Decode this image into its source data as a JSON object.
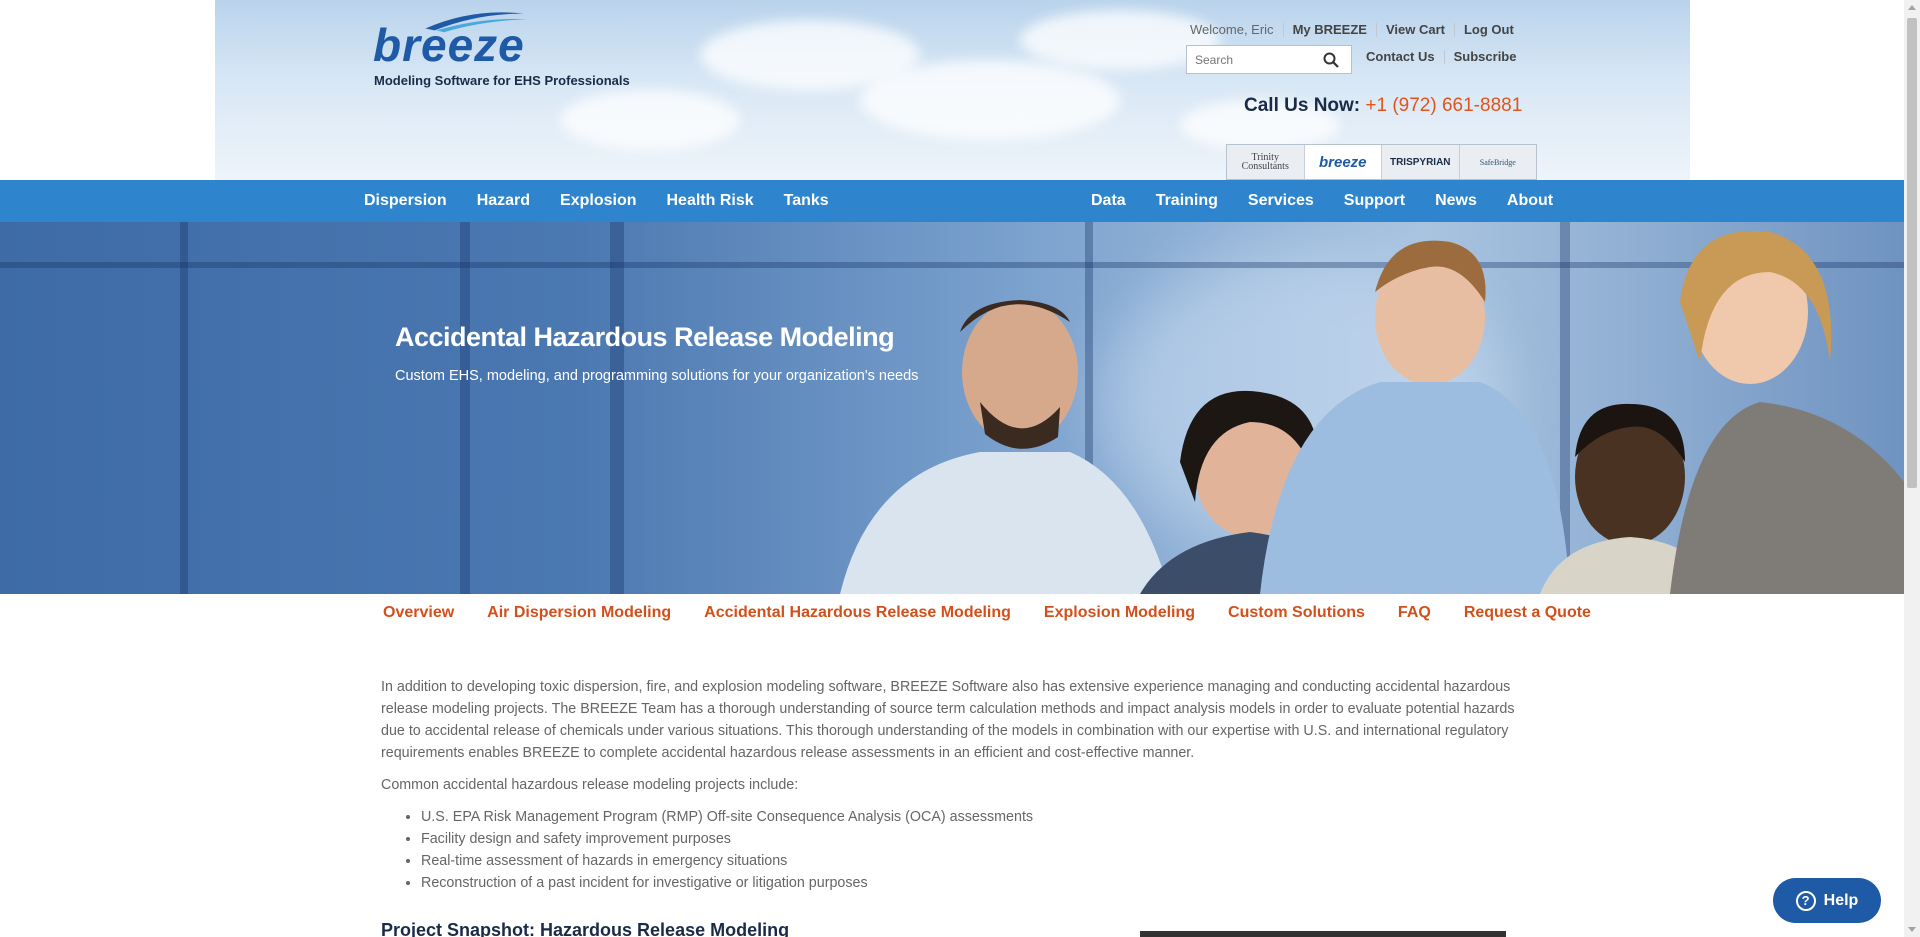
{
  "header": {
    "logo_text": "breeze",
    "tagline": "Modeling Software for EHS Professionals",
    "welcome": "Welcome, Eric",
    "my_breeze": "My BREEZE",
    "view_cart": "View Cart",
    "log_out": "Log Out",
    "search_placeholder": "Search",
    "contact_us": "Contact Us",
    "subscribe": "Subscribe",
    "call_label": "Call Us Now:",
    "phone": "+1 (972) 661-8881",
    "partners": [
      "Trinity Consultants",
      "breeze",
      "TRISPYRIAN",
      "SafeBridge"
    ]
  },
  "nav": {
    "left": [
      "Dispersion",
      "Hazard",
      "Explosion",
      "Health Risk",
      "Tanks"
    ],
    "right": [
      "Data",
      "Training",
      "Services",
      "Support",
      "News",
      "About"
    ]
  },
  "hero": {
    "title": "Accidental Hazardous Release Modeling",
    "subtitle": "Custom EHS, modeling, and programming solutions for your organization's needs"
  },
  "subnav": [
    "Overview",
    "Air Dispersion Modeling",
    "Accidental Hazardous Release Modeling",
    "Explosion Modeling",
    "Custom Solutions",
    "FAQ",
    "Request a Quote"
  ],
  "content": {
    "intro": "In addition to developing toxic dispersion, fire, and explosion modeling software, BREEZE Software also has extensive experience managing and conducting accidental hazardous release modeling projects. The BREEZE Team has a thorough understanding of source term calculation methods and impact analysis models in order to evaluate potential hazards due to accidental release of chemicals under various situations. This thorough understanding of the models in combination with our expertise with U.S. and international regulatory requirements enables BREEZE to complete accidental hazardous release assessments in an efficient and cost-effective manner.",
    "list_intro": "Common accidental hazardous release modeling projects include:",
    "items": [
      "U.S. EPA Risk Management Program (RMP) Off-site Consequence Analysis (OCA) assessments",
      "Facility design and safety improvement purposes",
      "Real-time assessment of hazards in emergency situations",
      "Reconstruction of a past incident for investigative or litigation purposes"
    ],
    "snapshot_title": "Project Snapshot: Hazardous Release Modeling"
  },
  "help": {
    "label": "Help"
  }
}
